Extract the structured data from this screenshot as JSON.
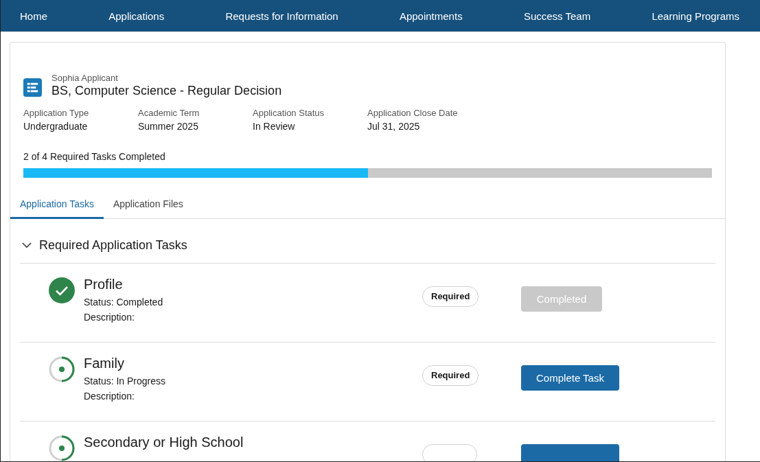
{
  "nav": [
    {
      "label": "Home"
    },
    {
      "label": "Applications"
    },
    {
      "label": "Requests for Information"
    },
    {
      "label": "Appointments"
    },
    {
      "label": "Success Team"
    },
    {
      "label": "Learning Programs"
    }
  ],
  "header": {
    "applicant": "Sophia Applicant",
    "title": "BS, Computer Science - Regular Decision"
  },
  "fields": [
    {
      "label": "Application Type",
      "value": "Undergraduate"
    },
    {
      "label": "Academic Term",
      "value": "Summer 2025"
    },
    {
      "label": "Application Status",
      "value": "In Review"
    },
    {
      "label": "Application Close Date",
      "value": "Jul 31, 2025"
    }
  ],
  "progress": {
    "label": "2 of 4 Required Tasks Completed",
    "level": 0.5
  },
  "tabs": [
    {
      "label": "Application Tasks",
      "selected": true
    },
    {
      "label": "Application Files",
      "selected": false
    }
  ],
  "section": {
    "title": "Required Application Tasks",
    "expanded": true
  },
  "tasks": [
    {
      "name": "Profile",
      "kind": "completed",
      "status": "Status: Completed",
      "description": "Description:",
      "badge": {
        "label": "Required"
      },
      "button": {
        "label": "Completed",
        "disabled": true
      }
    },
    {
      "name": "Family",
      "kind": "progress",
      "status": "Status: In Progress",
      "description": "Description:",
      "badge": {
        "label": "Required"
      },
      "button": {
        "label": "Complete Task",
        "disabled": false
      }
    },
    {
      "name": "Secondary or High School",
      "kind": "progress",
      "badge": {
        "shown": true
      },
      "button": {
        "disabled": false
      }
    }
  ]
}
